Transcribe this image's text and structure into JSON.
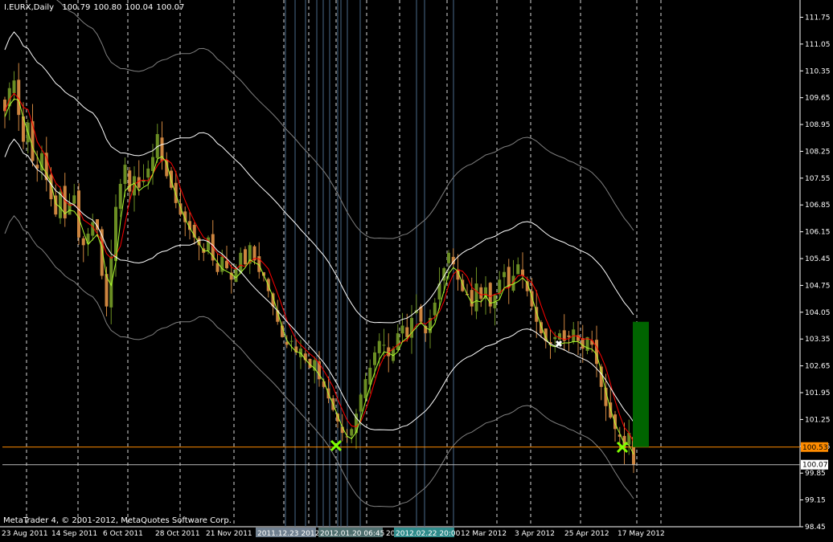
{
  "window": {
    "symbol_label": "I.EURX,Daily",
    "ohlc": [
      "100.79",
      "100.80",
      "100.04",
      "100.07"
    ],
    "copyright": "MetaTrader 4, © 2001-2012, MetaQuotes Software Corp."
  },
  "colors": {
    "background": "#000000",
    "bull_candle": "#6b8e23",
    "bear_candle": "#cd853f",
    "fast_ma": "#ff0000",
    "slow_ma": "#adff2f",
    "band_outer": "#808080",
    "band_mid": "#ffffff",
    "marker": "#7fff00",
    "horizontal_line": "#ff8c00",
    "target_box": "#006400",
    "vline_solid": "#4a6a8a"
  },
  "chart_data": {
    "type": "candlestick",
    "y_ticks": [
      "111.75",
      "111.05",
      "110.35",
      "109.65",
      "108.95",
      "108.25",
      "107.55",
      "106.85",
      "106.15",
      "105.45",
      "104.75",
      "104.05",
      "103.35",
      "102.65",
      "101.95",
      "101.25",
      "100.55",
      "99.85",
      "99.15",
      "98.45"
    ],
    "ylim": [
      98.45,
      112.2
    ],
    "x_ticks": [
      "23 Aug 2011",
      "14 Sep 2011",
      "6 Oct 2011",
      "28 Oct 2011",
      "21 Nov 2011",
      "12 Mar 2012",
      "3 Apr 2012",
      "25 Apr 2012",
      "17 May 2012"
    ],
    "x_time_labels": [
      "2011.12.23 2012",
      "2012.01.20 06:45",
      "20",
      "2012.02.22 20:00"
    ],
    "price_tags": [
      {
        "value": "100.53",
        "role": "horizontal-line-level"
      },
      {
        "value": "100.07",
        "role": "current-bid"
      }
    ],
    "marker_labels": [
      "x",
      "x",
      "x"
    ],
    "series_close": [
      109.3,
      109.9,
      110.1,
      109.2,
      108.5,
      109.0,
      108.0,
      107.8,
      108.2,
      107.5,
      107.0,
      106.6,
      107.2,
      106.5,
      106.9,
      107.1,
      106.0,
      105.8,
      106.1,
      106.4,
      106.2,
      105.0,
      104.2,
      105.5,
      106.8,
      107.4,
      107.9,
      107.2,
      107.6,
      107.3,
      107.5,
      107.8,
      108.1,
      108.7,
      108.0,
      107.6,
      107.3,
      106.9,
      106.6,
      106.4,
      106.2,
      106.0,
      105.8,
      105.6,
      106.0,
      105.4,
      105.1,
      105.5,
      105.2,
      104.9,
      105.2,
      105.6,
      105.3,
      105.8,
      105.4,
      105.1,
      105.0,
      104.6,
      104.2,
      103.8,
      103.4,
      103.2,
      103.3,
      103.0,
      103.1,
      102.8,
      102.6,
      102.8,
      102.3,
      102.1,
      101.8,
      101.5,
      101.2,
      100.9,
      100.8,
      101.0,
      101.4,
      101.9,
      102.3,
      102.6,
      103.0,
      103.3,
      103.2,
      102.9,
      103.1,
      103.5,
      103.7,
      103.4,
      103.9,
      104.1,
      103.8,
      103.5,
      103.9,
      104.3,
      104.8,
      105.2,
      105.6,
      105.3,
      104.9,
      104.6,
      104.5,
      104.2,
      104.8,
      104.4,
      104.7,
      104.2,
      104.5,
      104.9,
      105.1,
      104.7,
      105.0,
      105.3,
      105.0,
      104.6,
      104.2,
      103.8,
      103.5,
      103.3,
      103.2,
      103.4,
      103.5,
      103.3,
      103.4,
      103.6,
      103.3,
      103.1,
      103.4,
      103.2,
      102.7,
      102.1,
      101.6,
      101.3,
      101.0,
      100.8,
      100.5,
      100.9,
      100.07
    ]
  }
}
